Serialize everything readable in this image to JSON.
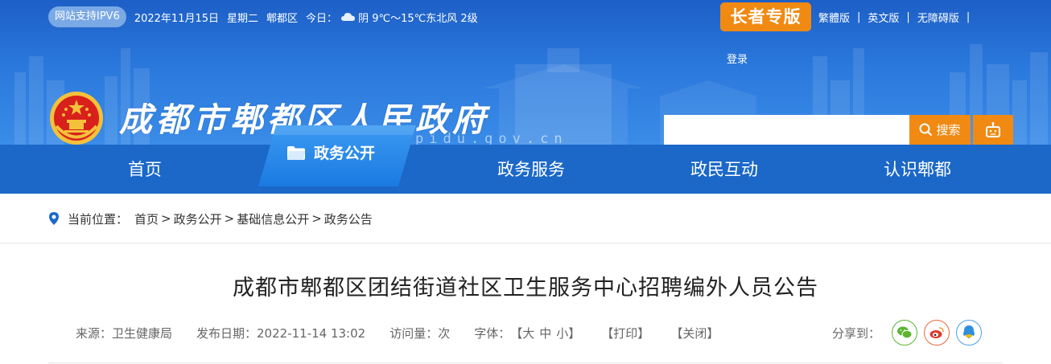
{
  "topbar": {
    "ipv6_badge": "网站支持IPV6",
    "date": "2022年11月15日",
    "weekday": "星期二",
    "district": "郫都区",
    "today_label": "今日：",
    "weather": "阴 9℃～15℃东北风 2级",
    "weather_icon": "cloud-icon"
  },
  "elder_mode": "长者专版",
  "toplinks": {
    "traditional": "繁體版",
    "english": "英文版",
    "accessible": "无障碍版",
    "login": "登录"
  },
  "header": {
    "site_title": "成都市郫都区人民政府",
    "domain": "pidu.gov.cn"
  },
  "search": {
    "placeholder": "",
    "button": "搜索",
    "robot_icon": "robot-icon"
  },
  "nav": {
    "items": [
      {
        "label": "首页"
      },
      {
        "label": "政务公开"
      },
      {
        "label": "政务服务"
      },
      {
        "label": "政民互动"
      },
      {
        "label": "认识郫都"
      }
    ],
    "active_index": 1
  },
  "breadcrumb": {
    "label": "当前位置：",
    "path": [
      "首页",
      "政务公开",
      "基础信息公开",
      "政务公告"
    ],
    "separator": ">"
  },
  "article": {
    "title": "成都市郫都区团结街道社区卫生服务中心招聘编外人员公告",
    "source": "来源：卫生健康局",
    "publish_date": "发布日期：2022-11-14 13:02",
    "views": "访问量：次",
    "font_label": "字体：",
    "font_open": "【",
    "font_sizes": [
      "大",
      "中",
      "小"
    ],
    "font_close": "】",
    "print": "【打印】",
    "close": "【关闭】"
  },
  "share": {
    "label": "分享到：",
    "targets": [
      {
        "name": "wechat",
        "color": "#5bb530"
      },
      {
        "name": "weibo",
        "color": "#e86a3a"
      },
      {
        "name": "qq",
        "color": "#4ba3e0"
      }
    ]
  },
  "colors": {
    "banner": "#2a78dc",
    "nav": "#1b68c8",
    "accent": "#f08a13"
  }
}
